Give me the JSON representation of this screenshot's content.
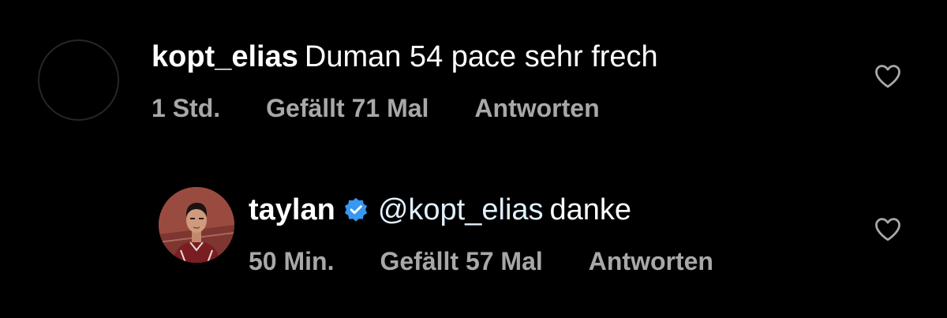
{
  "comments": [
    {
      "username": "kopt_elias",
      "text": "Duman 54 pace sehr frech",
      "time": "1 Std.",
      "likes": "Gefällt 71 Mal",
      "reply": "Antworten",
      "verified": false,
      "liked": false
    },
    {
      "username": "taylan",
      "mention": "@kopt_elias",
      "text": "danke",
      "time": "50 Min.",
      "likes": "Gefällt 57 Mal",
      "reply": "Antworten",
      "verified": true,
      "liked": false
    }
  ],
  "colors": {
    "background": "#000000",
    "primary_text": "#ffffff",
    "secondary_text": "#a8a8a8",
    "mention": "#e0f1ff",
    "verified_badge": "#3897f0"
  },
  "icons": {
    "like": "heart-outline-icon",
    "verified": "verified-badge-icon"
  }
}
